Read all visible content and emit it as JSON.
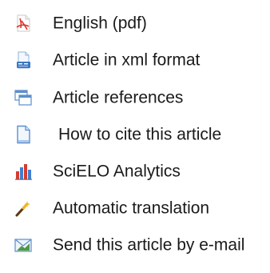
{
  "menu": {
    "items": [
      {
        "label": "English (pdf)",
        "icon": "pdf-icon"
      },
      {
        "label": "Article in xml format",
        "icon": "xml-document-icon"
      },
      {
        "label": "Article references",
        "icon": "references-windows-icon"
      },
      {
        "label": "How to cite this article",
        "icon": "page-icon"
      },
      {
        "label": "SciELO Analytics",
        "icon": "bar-chart-icon"
      },
      {
        "label": "Automatic translation",
        "icon": "magic-wand-icon"
      },
      {
        "label": "Send this article by e-mail",
        "icon": "email-icon"
      }
    ]
  },
  "colors": {
    "text": "#1a1a1a",
    "pdf_red": "#d9342b",
    "icon_blue": "#4a86c8",
    "chart_red": "#d63b2f",
    "chart_blue": "#3f7fd0",
    "wand_yellow": "#f2b51b",
    "mail_green": "#4f9a3c"
  }
}
